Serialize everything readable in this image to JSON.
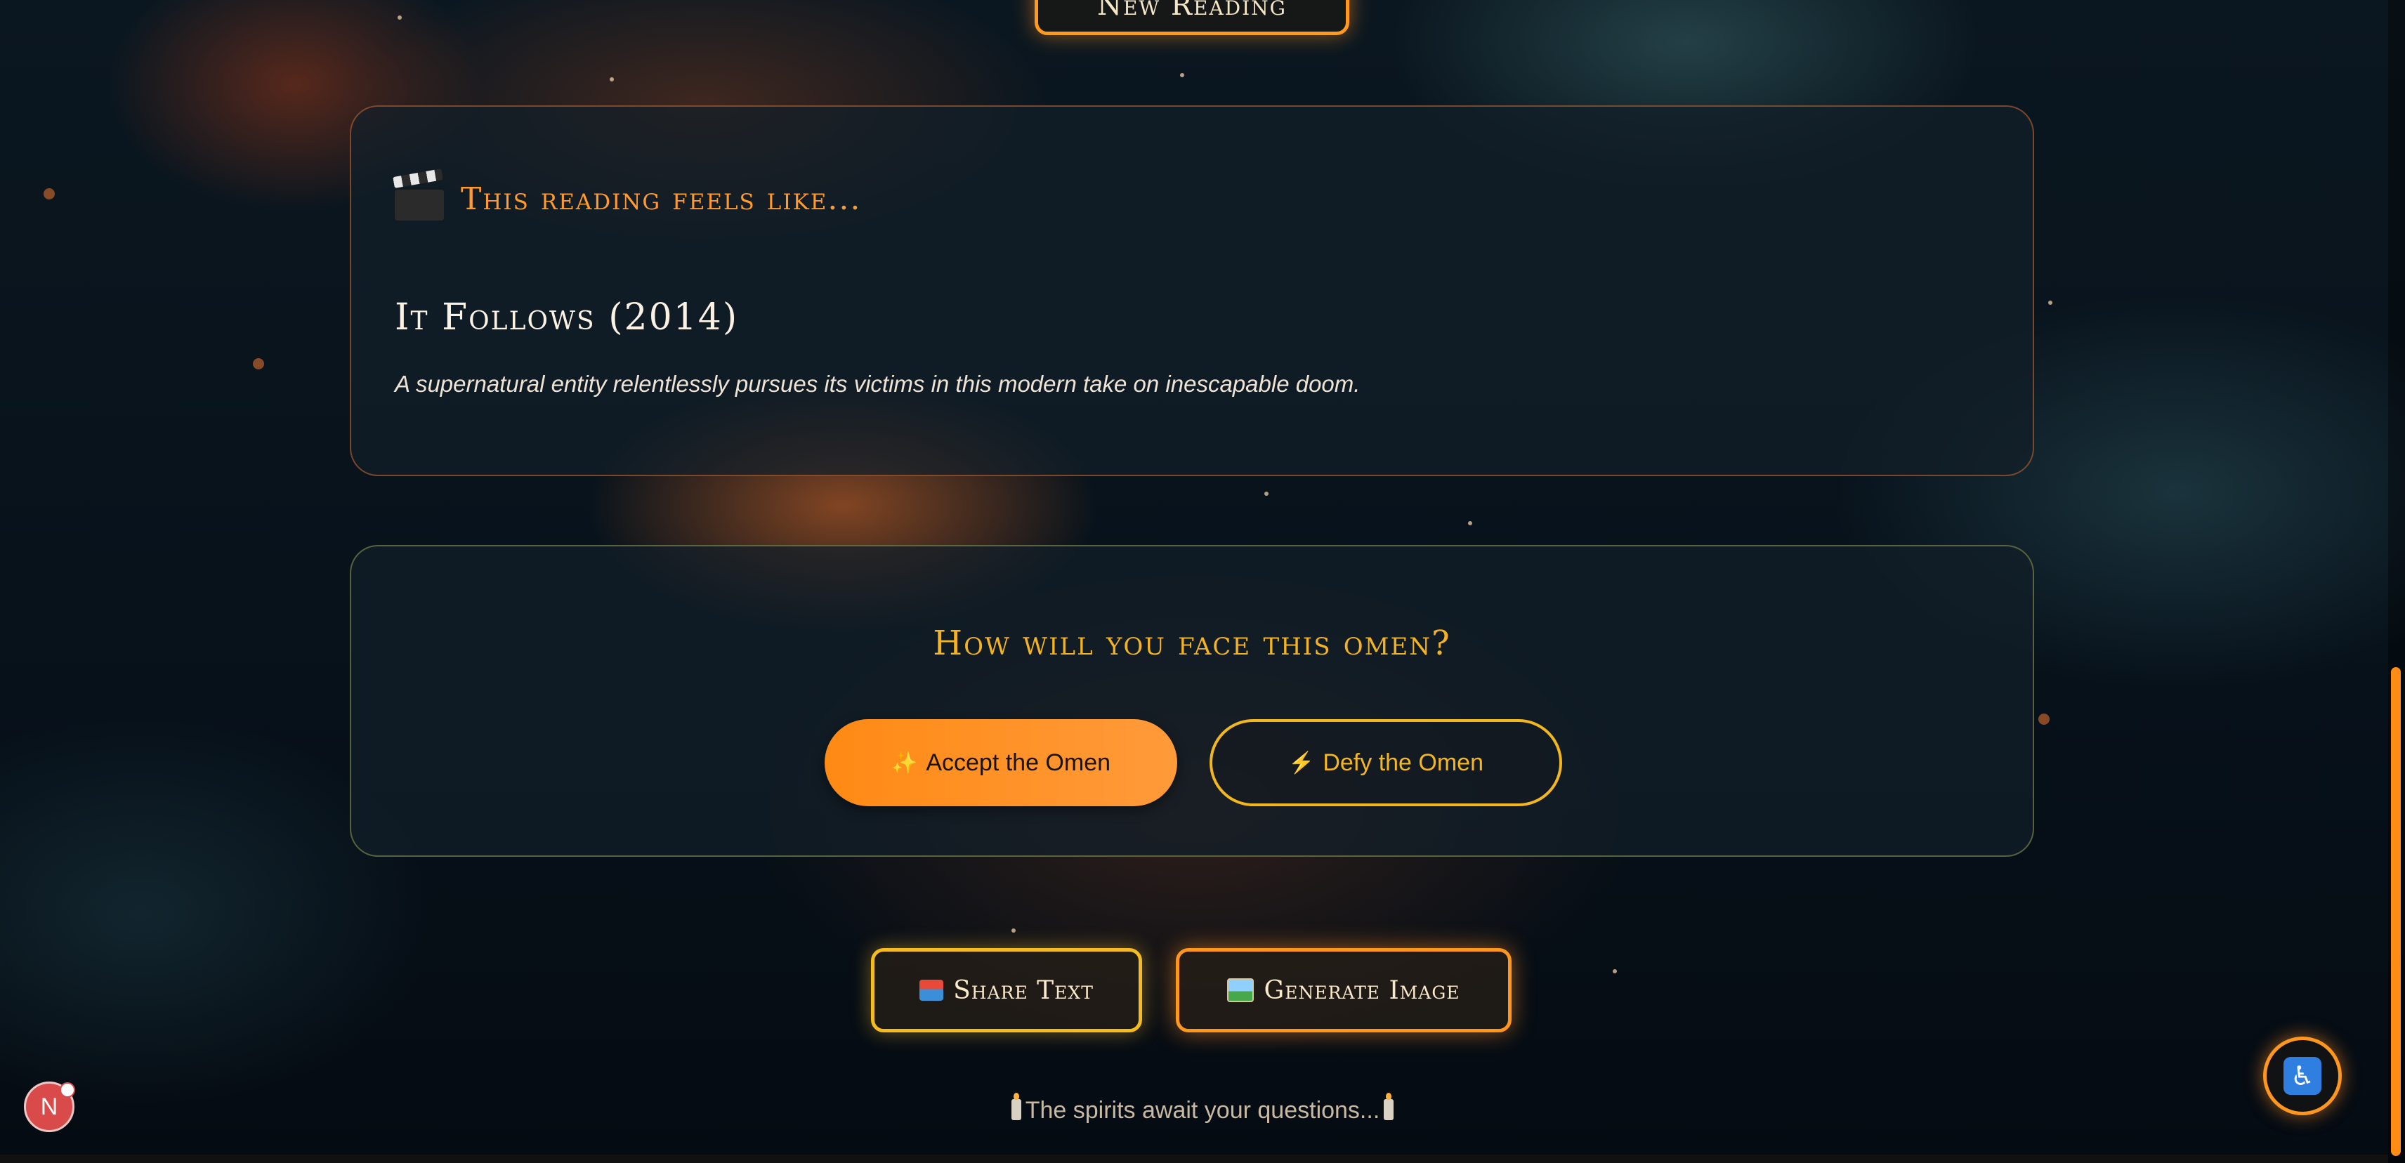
{
  "top_button": {
    "label": "New Reading"
  },
  "film_card": {
    "header": "This reading feels like...",
    "title": "It Follows (2014)",
    "description": "A supernatural entity relentlessly pursues its victims in this modern take on inescapable doom."
  },
  "omen_card": {
    "question": "How will you face this omen?",
    "accept_icon": "✨",
    "accept_label": "Accept the Omen",
    "defy_icon": "⚡",
    "defy_label": "Defy the Omen"
  },
  "share": {
    "share_text_label": "Share Text",
    "generate_image_label": "Generate Image"
  },
  "footer": {
    "text": "The spirits await your questions..."
  },
  "notification": {
    "letter": "N"
  },
  "accessibility": {
    "icon": "♿"
  },
  "colors": {
    "accent_orange": "#ff8a14",
    "accent_gold": "#f2b71e",
    "background": "#07111a"
  },
  "icons": [
    "clapper-board-icon",
    "sparkles-icon",
    "lightning-icon",
    "inbox-tray-icon",
    "framed-picture-icon",
    "candle-icon",
    "accessibility-icon"
  ]
}
